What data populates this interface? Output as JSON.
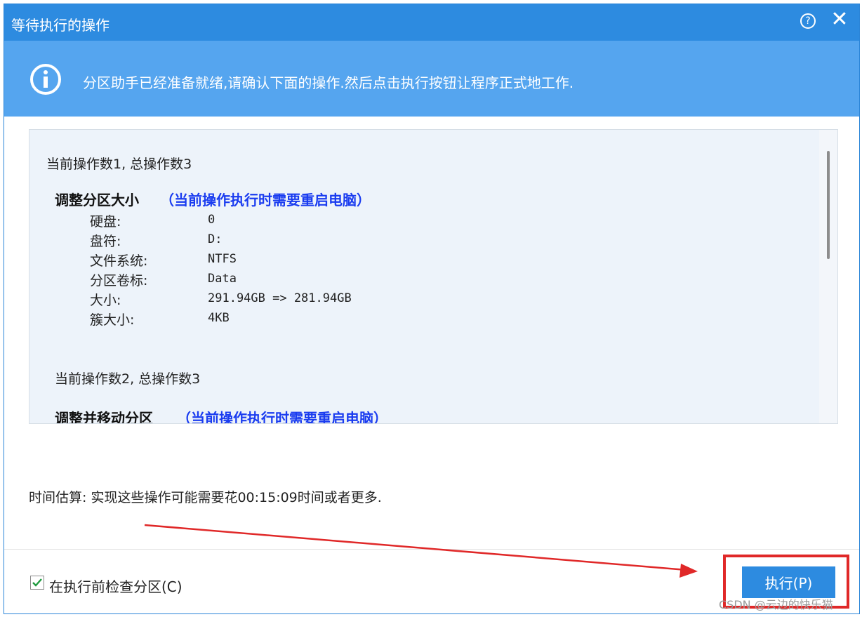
{
  "dialog": {
    "title": "等待执行的操作",
    "help_icon": "?",
    "close_icon": "✕"
  },
  "info": {
    "icon": "info-icon",
    "text": "分区助手已经准备就绪,请确认下面的操作.然后点击执行按钮让程序正式地工作."
  },
  "operations": [
    {
      "count": "当前操作数1, 总操作数3",
      "title": "调整分区大小",
      "note": "（当前操作执行时需要重启电脑）",
      "props": [
        {
          "label": "硬盘:",
          "value": "0"
        },
        {
          "label": "盘符:",
          "value": "D:"
        },
        {
          "label": "文件系统:",
          "value": "NTFS"
        },
        {
          "label": "分区卷标:",
          "value": "Data"
        },
        {
          "label": "大小:",
          "value": "291.94GB => 281.94GB"
        },
        {
          "label": "簇大小:",
          "value": "4KB"
        }
      ]
    },
    {
      "count": "当前操作数2, 总操作数3",
      "title": "调整并移动分区",
      "note": "（当前操作执行时需要重启电脑）"
    }
  ],
  "estimate": "时间估算: 实现这些操作可能需要花00:15:09时间或者更多.",
  "footer": {
    "check_label": "在执行前检查分区(C)",
    "checked": true,
    "execute_label": "执行(P)"
  },
  "colors": {
    "titlebar": "#2d8be0",
    "infobar": "#55a5ef",
    "panel": "#edf3fa",
    "note": "#1a3cf0",
    "annotation": "#e02828"
  },
  "watermark": "CSDN @云边的快乐猫"
}
